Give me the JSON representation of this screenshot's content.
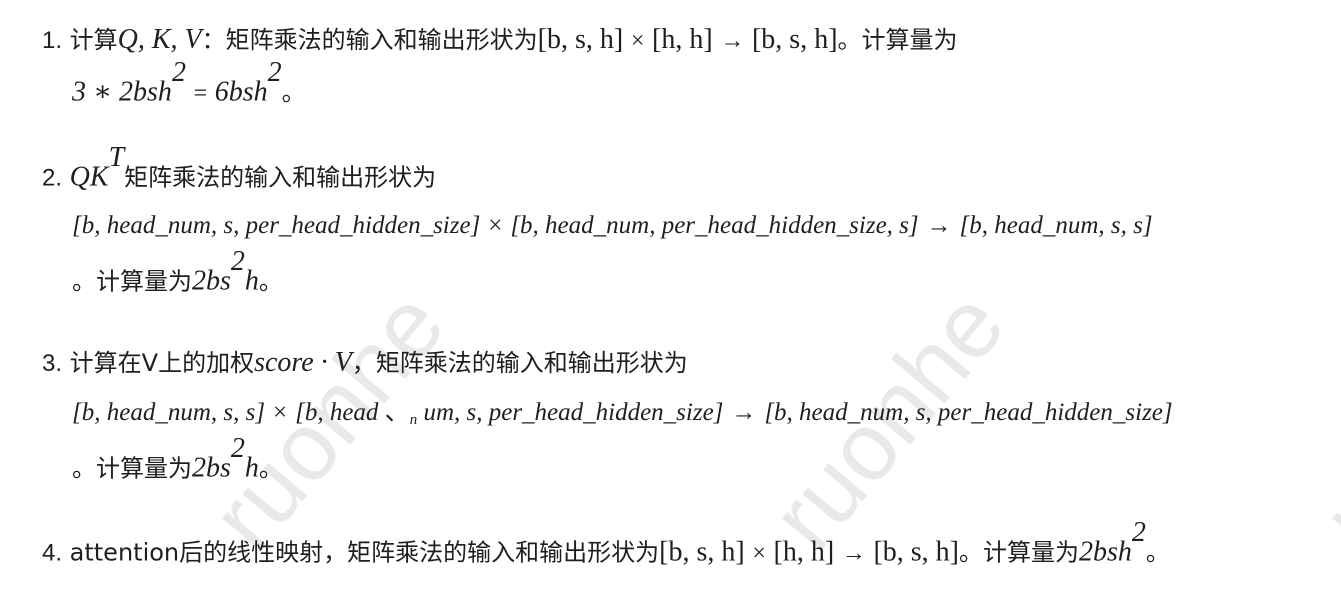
{
  "watermark": "ruonhe",
  "items": [
    {
      "num": "1.",
      "text_a": "计算",
      "math_qkv": "Q, K, V",
      "text_b": "：矩阵乘法的输入和输出形状为",
      "math_shape_a": "[b, s, h]",
      "op_times": "×",
      "math_shape_b": "[h, h]",
      "op_arrow": "→",
      "math_shape_c": "[b, s, h]",
      "text_c": "。计算量为",
      "math_cost_lhs": "3 ∗ 2bsh",
      "sup_2": "2",
      "op_eq": "=",
      "math_cost_rhs": "6bsh",
      "text_end": "。"
    },
    {
      "num": "2.",
      "math_qk": "QK",
      "sup_t": "T",
      "text_a": "矩阵乘法的输入和输出形状为",
      "math_shape_a": "[b, head_num, s, per_head_hidden_size]",
      "op_times": "×",
      "math_shape_b": "[b, head_num, per_head_hidden_size, s]",
      "op_arrow": "→",
      "math_shape_c": "[b, head_num, s, s]",
      "text_b": "。计算量为",
      "math_cost": "2bs",
      "sup_2": "2",
      "math_cost_end": "h",
      "text_end": "。"
    },
    {
      "num": "3.",
      "text_a": "计算在V上的加权",
      "math_score": "score · V",
      "text_b": "，矩阵乘法的输入和输出形状为",
      "math_shape_a": "[b, head_num, s, s]",
      "op_times": "×",
      "math_shape_b_pre": "[b, head",
      "math_shape_b_mark": "、",
      "math_shape_b_sub": "n",
      "math_shape_b_post": "um, s, per_head_hidden_size]",
      "op_arrow": "→",
      "math_shape_c": "[b, head_num, s, per_head_hidden_size]",
      "text_c": "。计算量为",
      "math_cost": "2bs",
      "sup_2": "2",
      "math_cost_end": "h",
      "text_end": "。"
    },
    {
      "num": "4.",
      "text_a": "attention后的线性映射，矩阵乘法的输入和输出形状为",
      "math_shape_a": "[b, s, h]",
      "op_times": "×",
      "math_shape_b": "[h, h]",
      "op_arrow": "→",
      "math_shape_c": "[b, s, h]",
      "text_b": "。计算量为",
      "math_cost": "2bsh",
      "sup_2": "2",
      "text_end": "。"
    }
  ]
}
